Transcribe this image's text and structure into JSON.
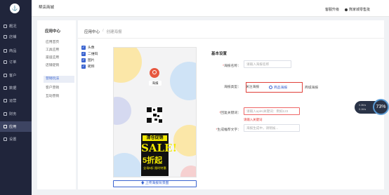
{
  "app": {
    "title": "帮店商城",
    "logo_glyph": "⚓"
  },
  "topbar": {
    "upgrade": "客服升级",
    "user": "熊家城零售批"
  },
  "sidebar": {
    "items": [
      {
        "label": "概况",
        "icon": "home-icon"
      },
      {
        "label": "店铺",
        "icon": "shop-icon"
      },
      {
        "label": "商品",
        "icon": "goods-icon"
      },
      {
        "label": "订单",
        "icon": "order-icon"
      },
      {
        "label": "客户",
        "icon": "customer-icon"
      },
      {
        "label": "数据",
        "icon": "data-icon"
      },
      {
        "label": "运营",
        "icon": "operations-icon"
      },
      {
        "label": "财务",
        "icon": "finance-icon"
      },
      {
        "label": "应用",
        "icon": "apps-icon",
        "active": true
      },
      {
        "label": "设置",
        "icon": "settings-icon"
      }
    ]
  },
  "subnav": {
    "header": "应用中心",
    "items": [
      "应用首页",
      "工具应用",
      "渠道应用",
      "店铺促销",
      "营销玩法",
      "客户营销",
      "互动营销"
    ]
  },
  "breadcrumb": {
    "root": "应用中心",
    "sep": "/",
    "current": "创建海报"
  },
  "elements": [
    {
      "label": "头像",
      "checked": true
    },
    {
      "label": "二维码",
      "checked": true
    },
    {
      "label": "图片",
      "checked": true
    },
    {
      "label": "昵称",
      "checked": true
    }
  ],
  "poster": {
    "nickname": "海报",
    "promo_top": "清仓促销",
    "promo_sale": "SALE!",
    "promo_discount": "5折起",
    "promo_small": "全场5折 限时特惠",
    "upload_label": "上传海报背景图"
  },
  "settings": {
    "title": "基本设置",
    "name_label": "海报名称：",
    "name_placeholder": "请输入海报名称",
    "type_label": "海报类型：",
    "type_options": [
      "关注海报",
      "商品海报",
      "商城海报"
    ],
    "type_selected": 1,
    "keyword_label": "回复关键词：",
    "keyword_placeholder": "请输入apiKi关键词：例如123",
    "keyword_error": "请输入关键词",
    "gen_label": "生成推荐文字：",
    "gen_placeholder": "海报生成中，请稍候..."
  },
  "widget": {
    "percent": "73%",
    "up": "0.3K/s",
    "down": "0.1K/s"
  },
  "colors": {
    "sidebar_bg": "#20253b",
    "accent": "#3a64d0",
    "error": "#e53935"
  }
}
